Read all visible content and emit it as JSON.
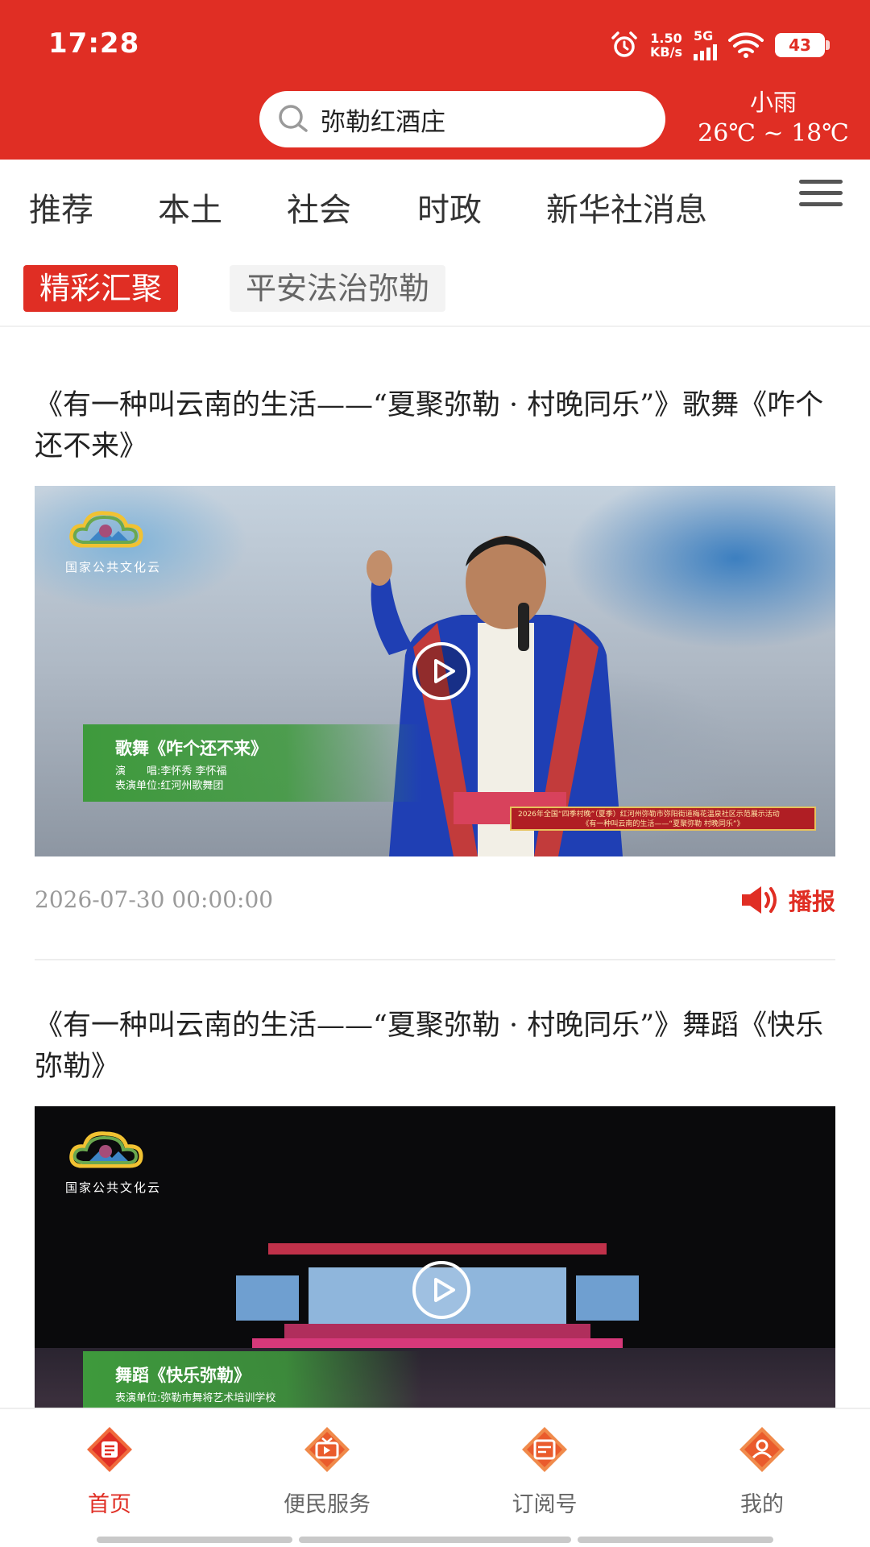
{
  "status_bar": {
    "time": "17:28",
    "net_speed_value": "1.50",
    "net_speed_unit": "KB/s",
    "network": "5G",
    "battery": "43"
  },
  "header": {
    "search_text": "弥勒红酒庄",
    "weather_condition": "小雨",
    "weather_temp": "26℃ ~ 18℃"
  },
  "channels": [
    "推荐",
    "本土",
    "社会",
    "时政",
    "新华社消息"
  ],
  "subtabs": {
    "active": "精彩汇聚",
    "inactive": "平安法治弥勒"
  },
  "articles": [
    {
      "title": "《有一种叫云南的生活——“夏聚弥勒 · 村晚同乐”》歌舞《咋个还不来》",
      "logo_text": "国家公共文化云",
      "caption_title": "歌舞《咋个还不来》",
      "caption_singer": "演　　唱:李怀秀 李怀福",
      "caption_unit": "表演单位:红河州歌舞团",
      "banner_line1": "2026年全国“四季村晚”（夏季）红河州弥勒市弥阳街道梅花温泉社区示范展示活动",
      "banner_line2": "《有一种叫云南的生活——“夏聚弥勒 村晚同乐”》",
      "date": "2026-07-30 00:00:00",
      "broadcast_label": "播报"
    },
    {
      "title": "《有一种叫云南的生活——“夏聚弥勒 · 村晚同乐”》舞蹈《快乐弥勒》",
      "logo_text": "国家公共文化云",
      "caption_title": "舞蹈《快乐弥勒》",
      "caption_unit": "表演单位:弥勒市舞将艺术培训学校"
    }
  ],
  "bottom_nav": [
    {
      "label": "首页",
      "icon": "home-icon"
    },
    {
      "label": "便民服务",
      "icon": "service-tv-icon"
    },
    {
      "label": "订阅号",
      "icon": "subscribe-icon"
    },
    {
      "label": "我的",
      "icon": "user-icon"
    }
  ],
  "colors": {
    "brand": "#e02e24",
    "text": "#222222",
    "muted": "#9a9a9a"
  }
}
